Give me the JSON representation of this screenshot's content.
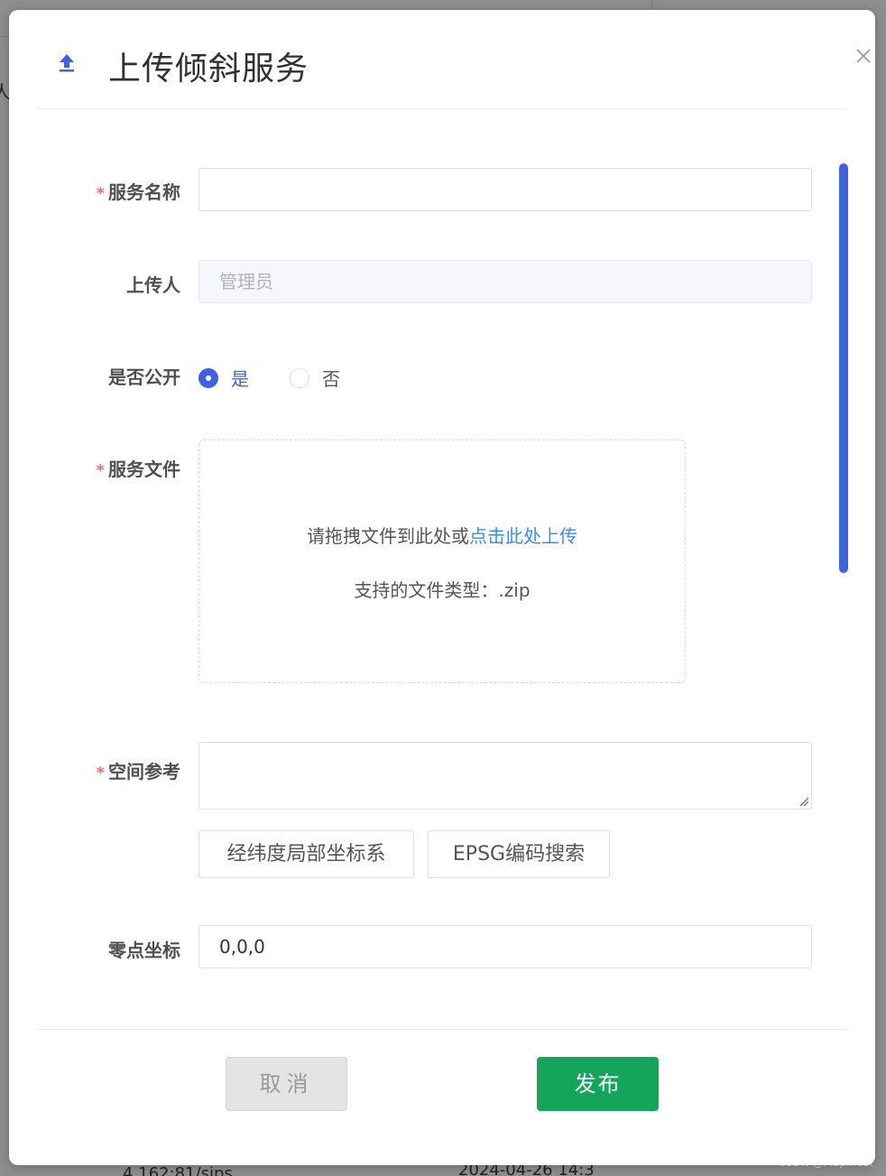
{
  "backdrop": {
    "left_char": "人",
    "bottom_left_text": "4.162:81/sips",
    "bottom_mid_text": "2024-04-26 14:3"
  },
  "watermark": "CSDN @Mapmost",
  "dialog": {
    "title": "上传倾斜服务",
    "icon": "upload-icon",
    "close_icon": "close-icon"
  },
  "form": {
    "required_mark": "*",
    "service_name": {
      "label": "服务名称",
      "required": true,
      "value": "",
      "placeholder": ""
    },
    "uploader": {
      "label": "上传人",
      "required": false,
      "value": "管理员",
      "disabled": true
    },
    "public": {
      "label": "是否公开",
      "options": [
        {
          "label": "是",
          "checked": true
        },
        {
          "label": "否",
          "checked": false
        }
      ]
    },
    "service_file": {
      "label": "服务文件",
      "required": true,
      "drop_text": "请拖拽文件到此处或",
      "drop_link": "点击此处上传",
      "hint": "支持的文件类型：.zip"
    },
    "spatial_ref": {
      "label": "空间参考",
      "required": true,
      "value": "",
      "buttons": [
        "经纬度局部坐标系",
        "EPSG编码搜索"
      ]
    },
    "origin": {
      "label": "零点坐标",
      "value": "0,0,0"
    }
  },
  "footer": {
    "cancel_label": "取消",
    "publish_label": "发布"
  },
  "colors": {
    "accent": "#3f63df",
    "link": "#3a8ee6",
    "publish": "#14a55a",
    "required": "#f56c6c"
  }
}
